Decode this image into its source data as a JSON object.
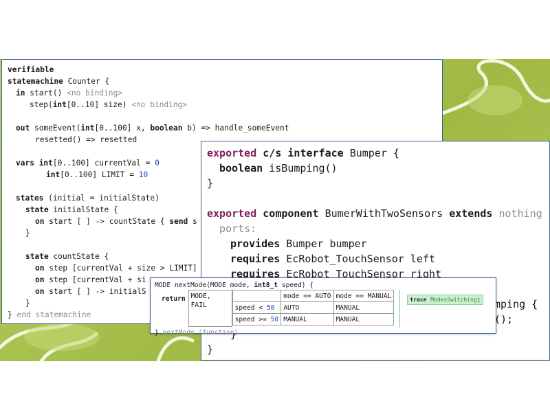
{
  "panel_statemachine": {
    "l1": {
      "kw": "verifiable"
    },
    "l2": {
      "kw": "statemachine",
      "rest": " Counter {"
    },
    "l3": {
      "kw": "in",
      "rest": " start() ",
      "gray": "<no binding>"
    },
    "l4": {
      "a": "step(",
      "kw": "int",
      "b": "[0..10] size) ",
      "gray": "<no binding>"
    },
    "l5": {
      "kw": "out",
      "a": " someEvent(",
      "kw2": "int",
      "b": "[0..100] x, ",
      "kw3": "boolean",
      "c": " b) => handle_someEvent"
    },
    "l6": {
      "a": "resetted() => resetted"
    },
    "l7": {
      "kw": "vars",
      "kw2": " int",
      "a": "[0..100] currentVal = ",
      "num": "0"
    },
    "l8": {
      "kw": "int",
      "a": "[0..100] LIMIT = ",
      "num": "10"
    },
    "l9": {
      "kw": "states",
      "a": " (initial = initialState)"
    },
    "l10": {
      "kw": "state",
      "a": " initialState {"
    },
    "l11": {
      "kw": "on",
      "a": " start [ ] -> countState { ",
      "kw2": "send",
      "b": " s"
    },
    "l12": {
      "a": "}"
    },
    "l13": {
      "kw": "state",
      "a": " countState {"
    },
    "l14": {
      "kw": "on",
      "a": " step [currentVal + size > LIMIT]"
    },
    "l15": {
      "kw": "on",
      "a": " step [currentVal + si"
    },
    "l16": {
      "kw": "on",
      "a": " start [ ] -> initialS"
    },
    "l17": {
      "a": "}"
    },
    "l18": {
      "a": "} ",
      "gray": "end statemachine"
    }
  },
  "panel_interface": {
    "l1": {
      "kw": "exported",
      "kw2": " c/s interface",
      "a": " Bumper {"
    },
    "l2": {
      "kw": "boolean",
      "a": " isBumping()"
    },
    "l3": {
      "a": "}"
    },
    "l4": {
      "kw": "exported",
      "kw2": " component",
      "a": " BumerWithTwoSensors ",
      "kw3": "extends",
      "gray": " nothing",
      "b": " {"
    },
    "l5": {
      "gray": "ports:"
    },
    "l6": {
      "kw": "provides",
      "a": " Bumper bumper"
    },
    "l7": {
      "kw": "requires",
      "a": " EcRobot_TouchSensor left"
    },
    "l8": {
      "kw": "requires",
      "a": " EcRobot_TouchSensor right"
    },
    "l9": {
      "a": "mping {"
    },
    "l10": {
      "a": "();"
    },
    "l11": {
      "a": "}"
    },
    "l12": {
      "a": "}"
    }
  },
  "panel_decision": {
    "header": {
      "a": "MODE nextMode(MODE mode, ",
      "kw": "int8_t",
      "b": " speed) {"
    },
    "return_kw": "return",
    "result": "MODE, FAIL",
    "col1": "mode == AUTO",
    "col2": "mode == MANUAL",
    "row1": {
      "a": "speed < ",
      "num": "50",
      "c1": "AUTO",
      "c2": "MANUAL"
    },
    "row2": {
      "a": "speed >= ",
      "num": "50",
      "c1": "MANUAL",
      "c2": "MANUAL"
    },
    "trace_kw": "trace",
    "trace_name": "ModesSwitching",
    "trace_end": ";",
    "footer": {
      "a": "} ",
      "gray": "nextMode (function)"
    }
  }
}
